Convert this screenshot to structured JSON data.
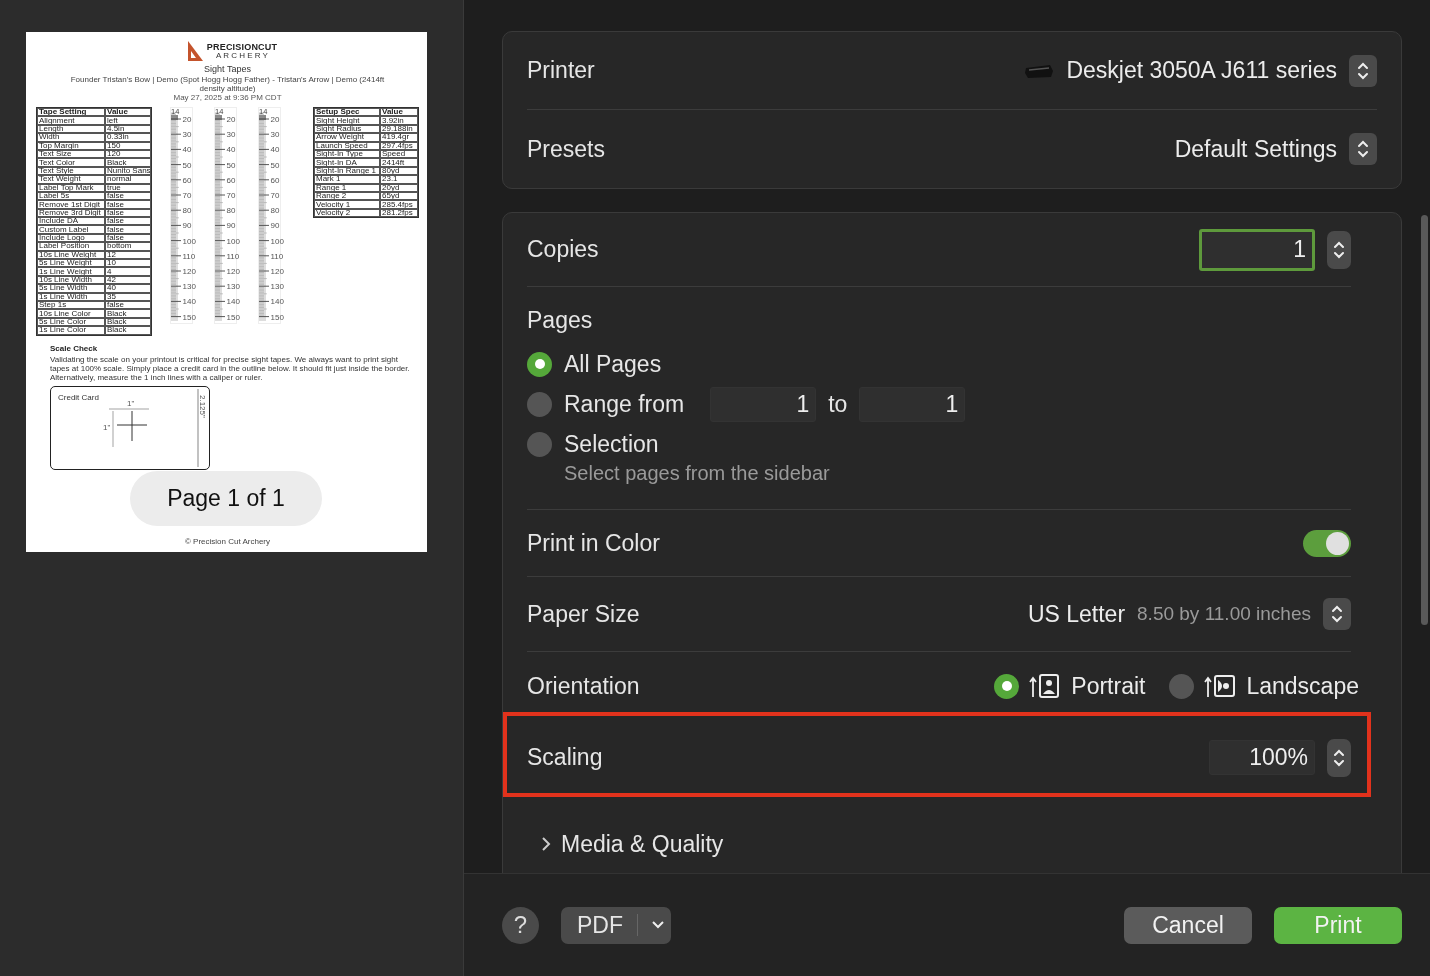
{
  "preview": {
    "logo": {
      "name": "PRECISIONCUT",
      "tagline": "A R C H E R Y"
    },
    "title": "Sight Tapes",
    "subtitle": "Founder Tristan's Bow | Demo (Spot Hogg Hogg Father) - Tristan's Arrow | Demo (2414ft density altitude)",
    "date": "May 27, 2025 at 9:36 PM CDT",
    "tape_settings": {
      "columns": [
        "Tape Setting",
        "Value"
      ],
      "rows": [
        [
          "Alignment",
          "left"
        ],
        [
          "Length",
          "4.5in"
        ],
        [
          "Width",
          "0.33in"
        ],
        [
          "Top Margin",
          "150"
        ],
        [
          "Text Size",
          "120"
        ],
        [
          "Text Color",
          "Black"
        ],
        [
          "Text Style",
          "Nunito Sans"
        ],
        [
          "Text Weight",
          "normal"
        ],
        [
          "Label Top Mark",
          "true"
        ],
        [
          "Label 5s",
          "false"
        ],
        [
          "Remove 1st Digit",
          "false"
        ],
        [
          "Remove 3rd Digit",
          "false"
        ],
        [
          "Include DA",
          "false"
        ],
        [
          "Custom Label",
          "false"
        ],
        [
          "Include Logo",
          "false"
        ],
        [
          "Label Position",
          "bottom"
        ],
        [
          "10s Line Weight",
          "12"
        ],
        [
          "5s Line Weight",
          "10"
        ],
        [
          "1s Line Weight",
          "4"
        ],
        [
          "10s Line Width",
          "42"
        ],
        [
          "5s Line Width",
          "40"
        ],
        [
          "1s Line Width",
          "35"
        ],
        [
          "Step 1s",
          "false"
        ],
        [
          "10s Line Color",
          "Black"
        ],
        [
          "5s Line Color",
          "Black"
        ],
        [
          "1s Line Color",
          "Black"
        ]
      ]
    },
    "tapes": [
      {
        "top_mark": "14",
        "labels": [
          "20",
          "30",
          "40",
          "50",
          "60",
          "70",
          "80",
          "90",
          "100",
          "110",
          "120",
          "130",
          "140",
          "150"
        ]
      },
      {
        "top_mark": "14",
        "labels": [
          "20",
          "30",
          "40",
          "50",
          "60",
          "70",
          "80",
          "90",
          "100",
          "110",
          "120",
          "130",
          "140",
          "150"
        ]
      },
      {
        "top_mark": "14",
        "labels": [
          "20",
          "30",
          "40",
          "50",
          "60",
          "70",
          "80",
          "90",
          "100",
          "110",
          "120",
          "130",
          "140",
          "150"
        ]
      }
    ],
    "setup_specs": {
      "columns": [
        "Setup Spec",
        "Value"
      ],
      "rows": [
        [
          "Sight Height",
          "3.92in"
        ],
        [
          "Sight Radius",
          "29.188in"
        ],
        [
          "Arrow Weight",
          "419.4gr"
        ],
        [
          "Launch Speed",
          "297.4fps"
        ],
        [
          "Sight-In Type",
          "Speed"
        ],
        [
          "Sight-In DA",
          "2414ft"
        ],
        [
          "Sight-In Range 1",
          "80yd"
        ],
        [
          "Mark 1",
          "23.1"
        ],
        [
          "Range 1",
          "20yd"
        ],
        [
          "Range 2",
          "65yd"
        ],
        [
          "Velocity 1",
          "285.4fps"
        ],
        [
          "Velocity 2",
          "281.2fps"
        ]
      ]
    },
    "scale_check": {
      "heading": "Scale Check",
      "text": "Validating the scale on your printout is critical for precise sight tapes. We always want to print sight tapes at 100% scale. Simply place a credit card in the outline below. It should fit just inside the border. Alternatively, measure the 1 inch lines with a caliper or ruler.",
      "card_label": "Credit Card",
      "width_label": "1\"",
      "height_label": "1\"",
      "side_label": "2.125\""
    },
    "footer": "© Precision Cut Archery",
    "page_indicator": "Page 1 of 1"
  },
  "printer": {
    "label": "Printer",
    "value": "Deskjet 3050A J611 series"
  },
  "presets": {
    "label": "Presets",
    "value": "Default Settings"
  },
  "copies": {
    "label": "Copies",
    "value": "1"
  },
  "pages": {
    "label": "Pages",
    "options": [
      {
        "label": "All Pages",
        "selected": true
      },
      {
        "label": "Range from",
        "selected": false,
        "from": "1",
        "to_label": "to",
        "to": "1"
      },
      {
        "label": "Selection",
        "selected": false,
        "hint": "Select pages from the sidebar"
      }
    ]
  },
  "print_in_color": {
    "label": "Print in Color",
    "on": true
  },
  "paper_size": {
    "label": "Paper Size",
    "value": "US Letter",
    "detail": "8.50 by 11.00 inches"
  },
  "orientation": {
    "label": "Orientation",
    "options": [
      {
        "label": "Portrait",
        "selected": true
      },
      {
        "label": "Landscape",
        "selected": false
      }
    ]
  },
  "scaling": {
    "label": "Scaling",
    "value": "100%",
    "highlighted": true
  },
  "media_quality": {
    "label": "Media & Quality",
    "expanded": false
  },
  "footer": {
    "help": "?",
    "pdf": "PDF",
    "cancel": "Cancel",
    "print": "Print"
  }
}
